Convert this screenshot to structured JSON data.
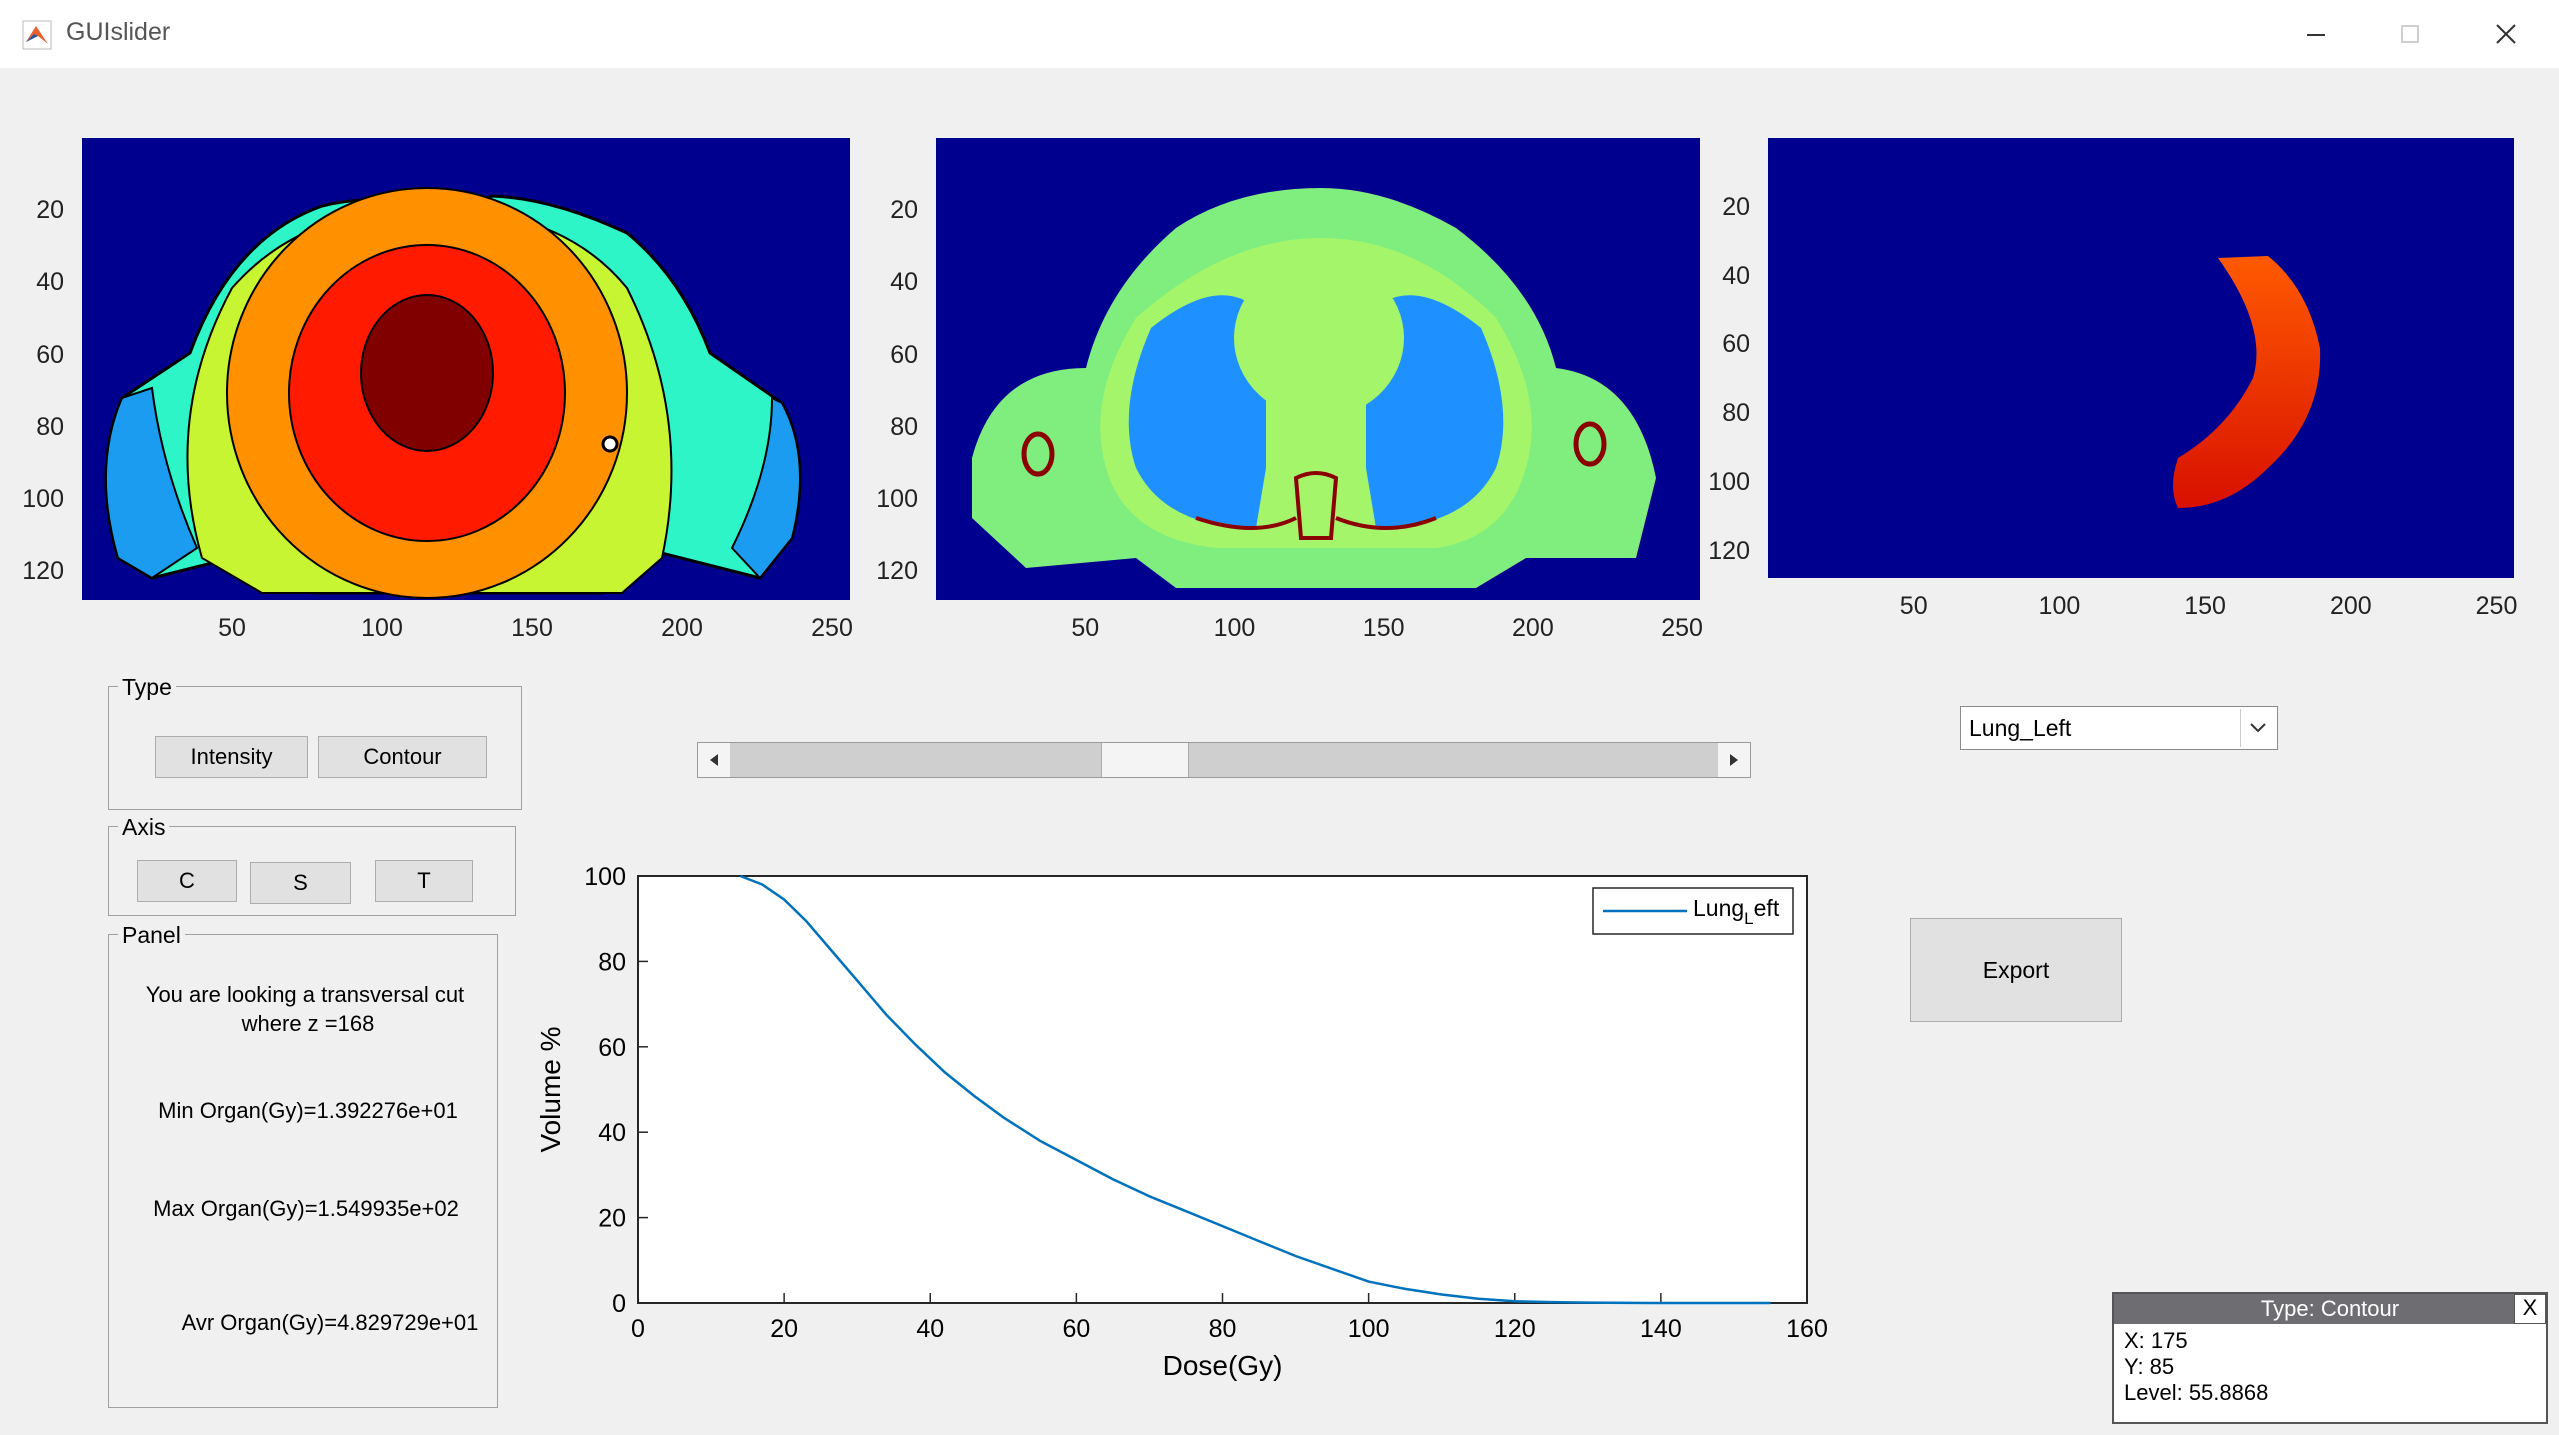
{
  "window": {
    "title": "GUIslider"
  },
  "axes_images": [
    {
      "name": "dose-map",
      "y_ticks": [
        "20",
        "40",
        "60",
        "80",
        "100",
        "120"
      ],
      "x_ticks": [
        "50",
        "100",
        "150",
        "200",
        "250"
      ]
    },
    {
      "name": "ct-slice",
      "y_ticks": [
        "20",
        "40",
        "60",
        "80",
        "100",
        "120"
      ],
      "x_ticks": [
        "50",
        "100",
        "150",
        "200",
        "250"
      ]
    },
    {
      "name": "organ-mask",
      "y_ticks": [
        "20",
        "40",
        "60",
        "80",
        "100",
        "120"
      ],
      "x_ticks": [
        "50",
        "100",
        "150",
        "200",
        "250"
      ]
    }
  ],
  "type_panel": {
    "title": "Type",
    "intensity_label": "Intensity",
    "contour_label": "Contour"
  },
  "axis_panel": {
    "title": "Axis",
    "c_label": "C",
    "s_label": "S",
    "t_label": "T"
  },
  "info_panel": {
    "title": "Panel",
    "line1": "You are looking a transversal cut",
    "line2": "where z =168",
    "min": "Min Organ(Gy)=1.392276e+01",
    "max": "Max Organ(Gy)=1.549935e+02",
    "avr": "Avr Organ(Gy)=4.829729e+01"
  },
  "slider": {
    "value_fraction": 0.41
  },
  "dropdown": {
    "selected": "Lung_Left"
  },
  "export_label": "Export",
  "datatip": {
    "title": "Type: Contour",
    "close": "X",
    "x": "X: 175",
    "y": "Y: 85",
    "level": "Level: 55.8868"
  },
  "colors": {
    "axes_bg": "#00008f",
    "curve": "#0072bd"
  },
  "chart_data": {
    "type": "line",
    "xlabel": "Dose(Gy)",
    "ylabel": "Volume %",
    "xlim": [
      0,
      160
    ],
    "ylim": [
      0,
      100
    ],
    "x_ticks": [
      "0",
      "20",
      "40",
      "60",
      "80",
      "100",
      "120",
      "140",
      "160"
    ],
    "y_ticks": [
      "0",
      "20",
      "40",
      "60",
      "80",
      "100"
    ],
    "legend_main": "Lung",
    "legend_sub": "L",
    "legend_rest": "eft",
    "legend_position": "top-right",
    "series": [
      {
        "x": [
          14,
          17,
          20,
          23,
          26,
          30,
          34,
          38,
          42,
          46,
          50,
          55,
          60,
          65,
          70,
          75,
          80,
          85,
          90,
          95,
          100,
          105,
          110,
          115,
          120,
          125,
          130,
          140,
          150,
          155
        ],
        "y": [
          100,
          98,
          94.5,
          89.5,
          83.5,
          75.5,
          67.5,
          60.5,
          54,
          48.5,
          43.5,
          38,
          33.5,
          29,
          25,
          21.5,
          18,
          14.5,
          11,
          8,
          5,
          3.3,
          2,
          1,
          0.4,
          0.2,
          0.1,
          0,
          0,
          0
        ]
      }
    ]
  }
}
